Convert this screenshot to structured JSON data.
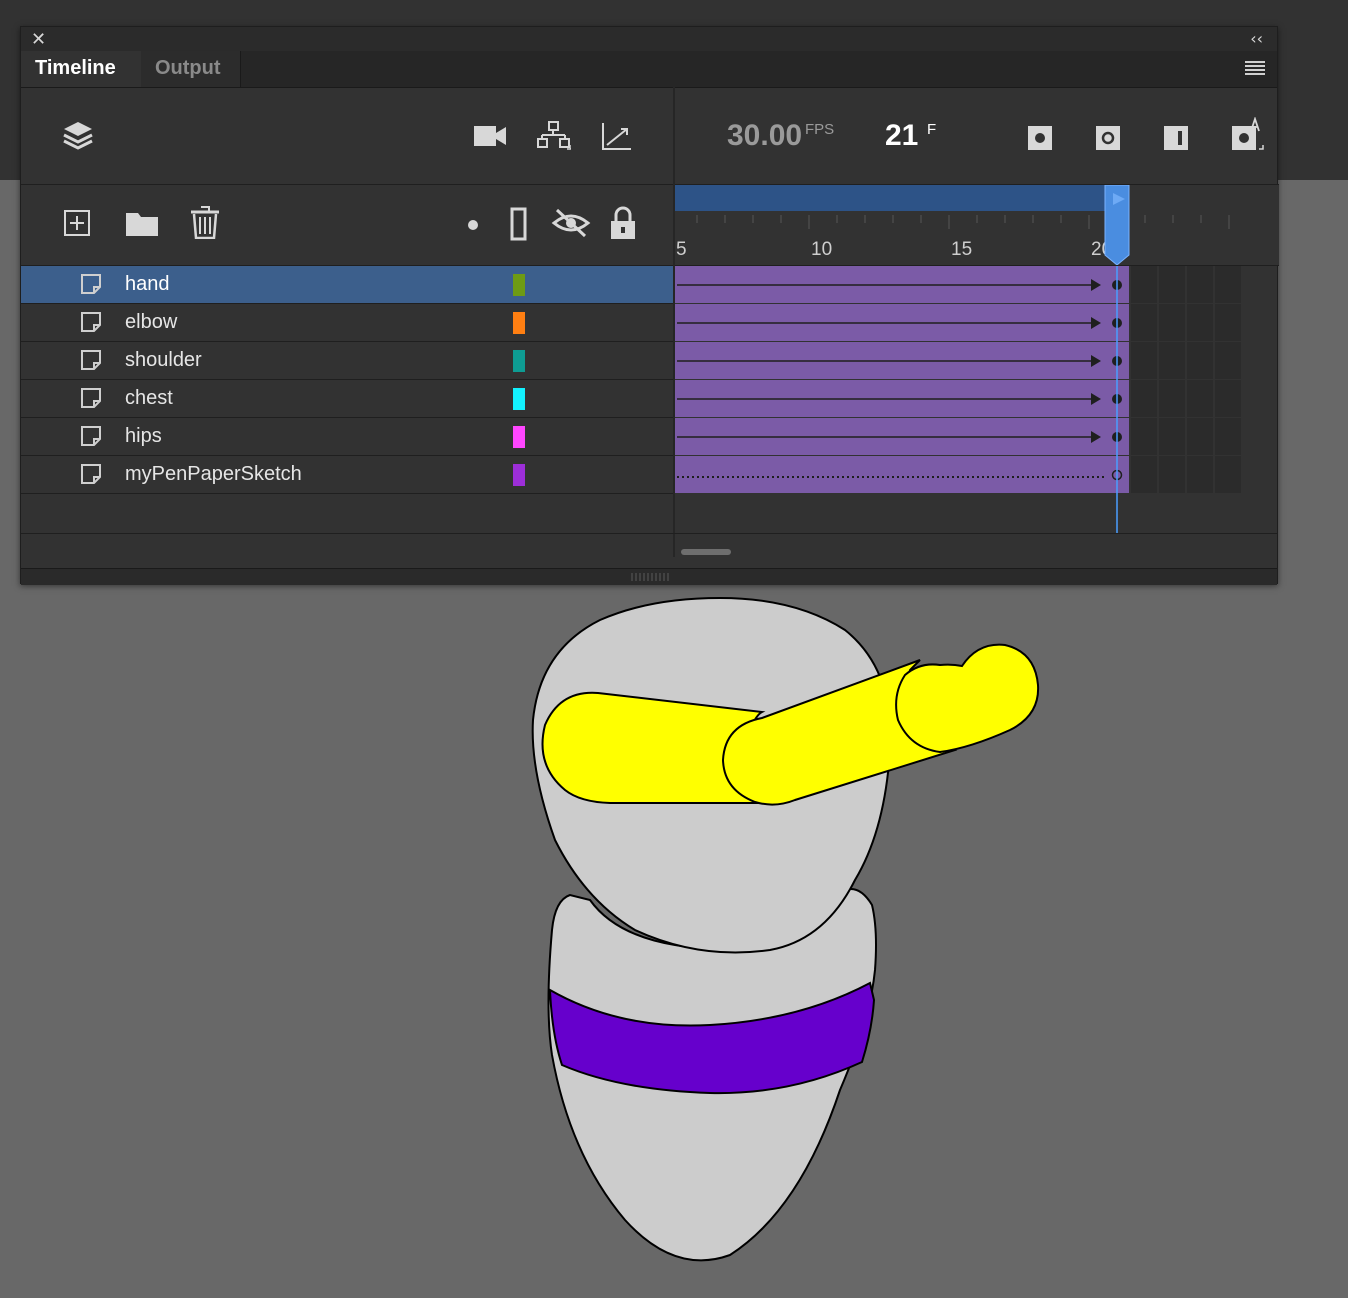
{
  "panel": {
    "close_glyph": "✕",
    "collapse_glyph": "‹‹",
    "tabs": [
      {
        "label": "Timeline",
        "active": true
      },
      {
        "label": "Output",
        "active": false
      }
    ]
  },
  "toolbar": {
    "icons_left": [
      "layers-icon",
      "camera-icon",
      "layer-parenting-icon",
      "graph-icon"
    ],
    "icons_second": [
      "new-layer-icon",
      "new-folder-icon",
      "delete-icon",
      "highlight-dot-icon",
      "outline-icon",
      "visibility-icon",
      "lock-icon"
    ],
    "icons_right": [
      "insert-keyframe-icon",
      "insert-blank-keyframe-icon",
      "insert-frame-icon",
      "auto-keyframe-icon"
    ]
  },
  "playback": {
    "fps_value": "30.00",
    "fps_label": "FPS",
    "frame_value": "21",
    "frame_label": "F",
    "current_frame": 21
  },
  "ruler": {
    "ticks": [
      {
        "frame": 5,
        "label": "5"
      },
      {
        "frame": 10,
        "label": "10"
      },
      {
        "frame": 15,
        "label": "15"
      },
      {
        "frame": 20,
        "label": "20"
      }
    ]
  },
  "layers": [
    {
      "name": "hand",
      "color": "#6e9b13",
      "selected": true,
      "tween": true
    },
    {
      "name": "elbow",
      "color": "#ff7f12",
      "selected": false,
      "tween": true
    },
    {
      "name": "shoulder",
      "color": "#0e9c93",
      "selected": false,
      "tween": true
    },
    {
      "name": "chest",
      "color": "#12f2ff",
      "selected": false,
      "tween": true
    },
    {
      "name": "hips",
      "color": "#ff46ff",
      "selected": false,
      "tween": true
    },
    {
      "name": "myPenPaperSketch",
      "color": "#9d2ed9",
      "selected": false,
      "tween": false
    }
  ],
  "colors": {
    "accent": "#3c5f8c",
    "frame_span": "#7b5ba7",
    "playhead": "#4a9eff",
    "figure_yellow": "#ffff00",
    "figure_band": "#6600cc",
    "figure_body": "#cccccc"
  }
}
